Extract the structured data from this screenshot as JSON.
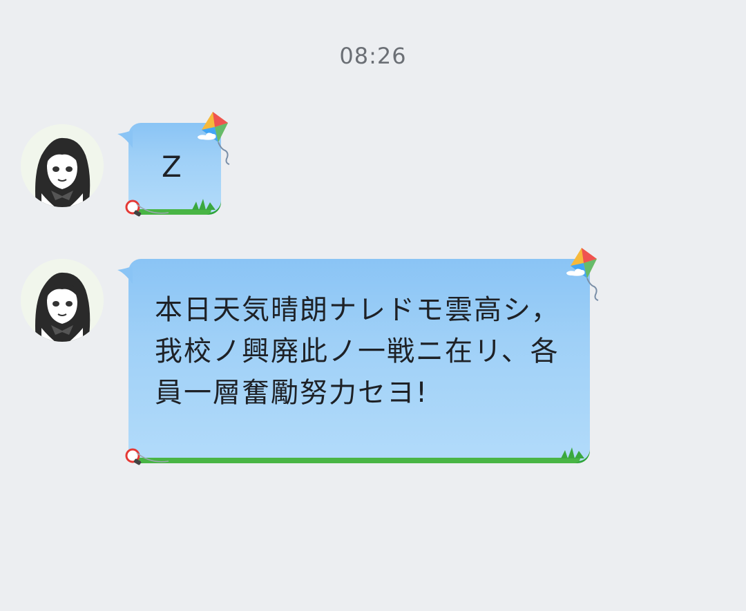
{
  "timestamp": "08:26",
  "messages": [
    {
      "sender_avatar": "avatar-icon",
      "text": "Z"
    },
    {
      "sender_avatar": "avatar-icon",
      "text": "本日天気晴朗ナレドモ雲高シ，我校ノ興廃此ノ一戦ニ在リ、各員一層奮勵努力セヨ!"
    }
  ],
  "colors": {
    "background": "#eceef1",
    "bubble_top": "#8ac4f5",
    "bubble_bottom": "#b2dbfa",
    "grass": "#49b545",
    "timestamp": "#6b6f75"
  }
}
